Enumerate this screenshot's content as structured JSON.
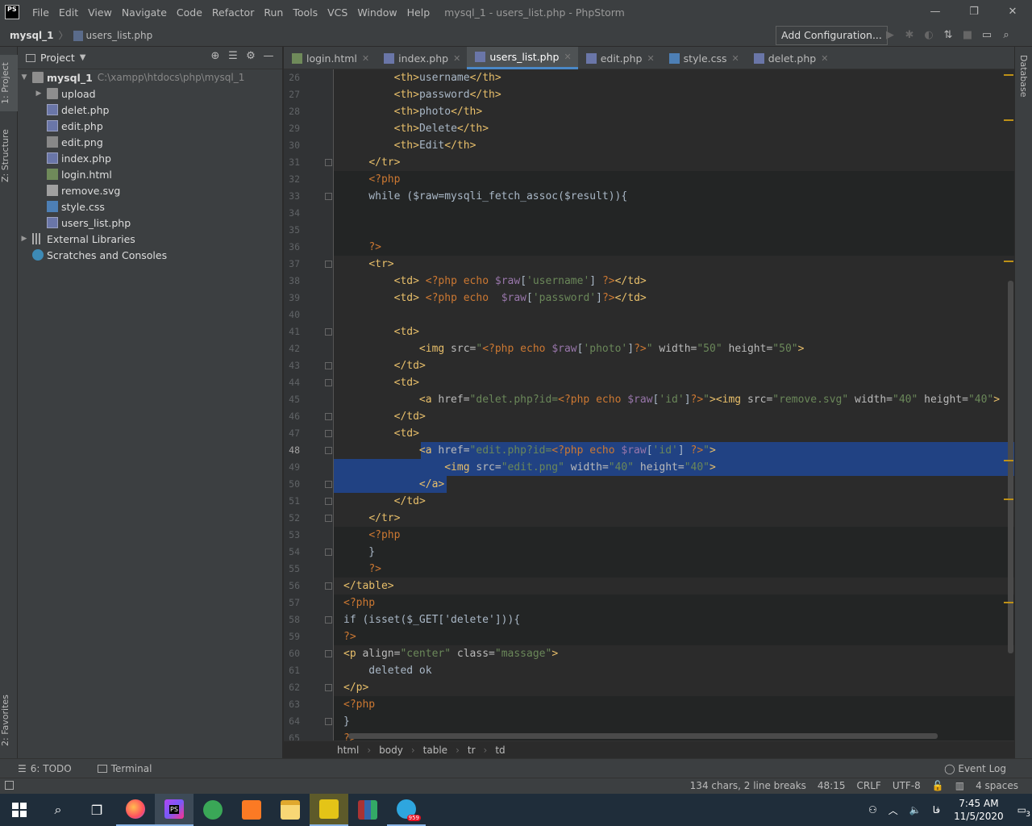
{
  "titlebar": {
    "app_icon": "PS",
    "menu": [
      "File",
      "Edit",
      "View",
      "Navigate",
      "Code",
      "Refactor",
      "Run",
      "Tools",
      "VCS",
      "Window",
      "Help"
    ],
    "window_title": "mysql_1 - users_list.php - PhpStorm",
    "minimize": "—",
    "restore": "❐",
    "close": "✕"
  },
  "navbar": {
    "project": "mysql_1",
    "file": "users_list.php",
    "add_configuration": "Add Configuration...",
    "tools": [
      "play-icon",
      "debug-icon",
      "coverage-icon",
      "update-icon",
      "stop-icon",
      "layout-icon",
      "search-icon"
    ]
  },
  "left_strip": {
    "project_tab": "1: Project",
    "structure_tab": "Z: Structure",
    "favorites_tab": "2: Favorites"
  },
  "right_strip": {
    "database_tab": "Database"
  },
  "project_panel": {
    "title": "Project",
    "tree": [
      {
        "label": "mysql_1",
        "path": "C:\\xampp\\htdocs\\php\\mysql_1",
        "icon": "folder-icon",
        "level": 0,
        "arrow": "▼",
        "bold": true
      },
      {
        "label": "upload",
        "icon": "folder-icon",
        "level": 1,
        "arrow": "▶"
      },
      {
        "label": "delet.php",
        "icon": "php-file-icon",
        "level": 1
      },
      {
        "label": "edit.php",
        "icon": "php-file-icon",
        "level": 1
      },
      {
        "label": "edit.png",
        "icon": "image-file-icon",
        "level": 1
      },
      {
        "label": "index.php",
        "icon": "php-file-icon",
        "level": 1
      },
      {
        "label": "login.html",
        "icon": "html-file-icon",
        "level": 1
      },
      {
        "label": "remove.svg",
        "icon": "svg-file-icon",
        "level": 1
      },
      {
        "label": "style.css",
        "icon": "css-file-icon",
        "level": 1
      },
      {
        "label": "users_list.php",
        "icon": "php-file-icon",
        "level": 1
      },
      {
        "label": "External Libraries",
        "icon": "library-icon",
        "level": 0,
        "arrow": "▶"
      },
      {
        "label": "Scratches and Consoles",
        "icon": "scratches-icon",
        "level": 0
      }
    ]
  },
  "tabs": [
    {
      "label": "login.html",
      "icon": "html-file-icon",
      "active": false
    },
    {
      "label": "index.php",
      "icon": "php-file-icon",
      "active": false
    },
    {
      "label": "users_list.php",
      "icon": "php-file-icon",
      "active": true
    },
    {
      "label": "edit.php",
      "icon": "php-file-icon",
      "active": false
    },
    {
      "label": "style.css",
      "icon": "css-file-icon",
      "active": false
    },
    {
      "label": "delet.php",
      "icon": "php-file-icon",
      "active": false
    }
  ],
  "editor": {
    "current_line": 48,
    "lines": [
      {
        "n": 26,
        "code": "        <th>username</th>"
      },
      {
        "n": 27,
        "code": "        <th>password</th>"
      },
      {
        "n": 28,
        "code": "        <th>photo</th>"
      },
      {
        "n": 29,
        "code": "        <th>Delete</th>"
      },
      {
        "n": 30,
        "code": "        <th>Edit</th>"
      },
      {
        "n": 31,
        "code": "    </tr>"
      },
      {
        "n": 32,
        "code": "    <?php"
      },
      {
        "n": 33,
        "code": "    while ($raw=mysqli_fetch_assoc($result)){"
      },
      {
        "n": 34,
        "code": ""
      },
      {
        "n": 35,
        "code": ""
      },
      {
        "n": 36,
        "code": "    ?>"
      },
      {
        "n": 37,
        "code": "    <tr>"
      },
      {
        "n": 38,
        "code": "        <td> <?php echo $raw['username'] ?></td>"
      },
      {
        "n": 39,
        "code": "        <td> <?php echo  $raw['password']?></td>"
      },
      {
        "n": 40,
        "code": ""
      },
      {
        "n": 41,
        "code": "        <td>"
      },
      {
        "n": 42,
        "code": "            <img src=\"<?php echo $raw['photo']?>\" width=\"50\" height=\"50\">"
      },
      {
        "n": 43,
        "code": "        </td>"
      },
      {
        "n": 44,
        "code": "        <td>"
      },
      {
        "n": 45,
        "code": "            <a href=\"delet.php?id=<?php echo $raw['id']?>\"><img src=\"remove.svg\" width=\"40\" height=\"40\">"
      },
      {
        "n": 46,
        "code": "        </td>"
      },
      {
        "n": 47,
        "code": "        <td>"
      },
      {
        "n": 48,
        "code": "            <a href=\"edit.php?id=<?php echo $raw['id'] ?>\">"
      },
      {
        "n": 49,
        "code": "                <img src=\"edit.png\" width=\"40\" height=\"40\">"
      },
      {
        "n": 50,
        "code": "            </a>"
      },
      {
        "n": 51,
        "code": "        </td>"
      },
      {
        "n": 52,
        "code": "    </tr>"
      },
      {
        "n": 53,
        "code": "    <?php"
      },
      {
        "n": 54,
        "code": "    }"
      },
      {
        "n": 55,
        "code": "    ?>"
      },
      {
        "n": 56,
        "code": "</table>"
      },
      {
        "n": 57,
        "code": "<?php"
      },
      {
        "n": 58,
        "code": "if (isset($_GET['delete'])){"
      },
      {
        "n": 59,
        "code": "?>"
      },
      {
        "n": 60,
        "code": "<p align=\"center\" class=\"massage\">"
      },
      {
        "n": 61,
        "code": "    deleted ok"
      },
      {
        "n": 62,
        "code": "</p>"
      },
      {
        "n": 63,
        "code": "<?php"
      },
      {
        "n": 64,
        "code": "}"
      },
      {
        "n": 65,
        "code": "?>"
      }
    ]
  },
  "editor_breadcrumbs": [
    "html",
    "body",
    "table",
    "tr",
    "td"
  ],
  "bottom_toolbar": {
    "todo": "6: TODO",
    "terminal": "Terminal",
    "event_log": "Event Log"
  },
  "status_bar": {
    "selection": "134 chars, 2 line breaks",
    "position": "48:15",
    "line_sep": "CRLF",
    "encoding": "UTF-8",
    "indent": "4 spaces"
  },
  "taskbar": {
    "apps": [
      {
        "name": "start-icon"
      },
      {
        "name": "search-icon"
      },
      {
        "name": "task-view-icon"
      },
      {
        "name": "firefox-icon"
      },
      {
        "name": "phpstorm-icon"
      },
      {
        "name": "telegram-alt-icon"
      },
      {
        "name": "xampp-icon"
      },
      {
        "name": "file-explorer-icon"
      },
      {
        "name": "app-yellow-icon"
      },
      {
        "name": "winrar-icon"
      },
      {
        "name": "telegram-icon",
        "badge": "959"
      }
    ],
    "time": "7:45 AM",
    "date": "11/5/2020",
    "language": "فا",
    "notifications": "3"
  },
  "colors": {
    "selection": "#214283",
    "tag": "#e8bf6a",
    "string": "#6a8759",
    "keyword": "#cc7832",
    "variable": "#9876aa",
    "function": "#ffc66d"
  }
}
